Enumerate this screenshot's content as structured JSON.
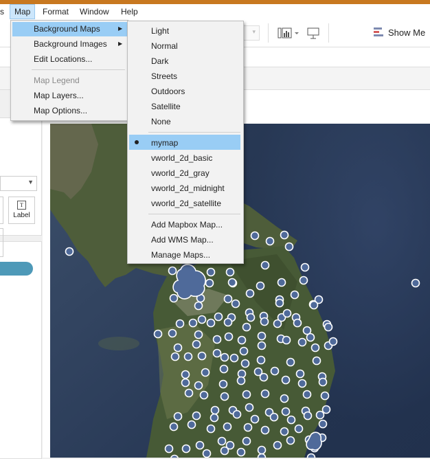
{
  "menubar": {
    "items": [
      {
        "label": "s"
      },
      {
        "label": "Map"
      },
      {
        "label": "Format"
      },
      {
        "label": "Window"
      },
      {
        "label": "Help"
      }
    ]
  },
  "toolbar": {
    "show_me_label": "Show Me"
  },
  "left_pane": {
    "label_button": "Label",
    "label_icon_glyph": "T"
  },
  "map_menu": {
    "items": [
      {
        "label": "Background Maps",
        "submenu": true,
        "highlighted": true
      },
      {
        "label": "Background Images",
        "submenu": true
      },
      {
        "label": "Edit Locations..."
      },
      {
        "label": "Map Legend",
        "disabled": true
      },
      {
        "label": "Map Layers..."
      },
      {
        "label": "Map Options..."
      }
    ]
  },
  "background_maps_menu": {
    "builtin": [
      "Light",
      "Normal",
      "Dark",
      "Streets",
      "Outdoors",
      "Satellite",
      "None"
    ],
    "custom": [
      "mymap",
      "vworld_2d_basic",
      "vworld_2d_gray",
      "vworld_2d_midnight",
      "vworld_2d_satellite"
    ],
    "selected": "mymap",
    "manage": [
      "Add Mapbox Map...",
      "Add WMS Map...",
      "Manage Maps..."
    ]
  },
  "colors": {
    "accent_strip": "#c87820",
    "menu_highlight": "#99cdf5",
    "map_point_fill": "#4f6a9a",
    "map_point_stroke": "#ffffff",
    "sea": "#2c3f5c",
    "land": "#4a5e3e"
  },
  "icons": [
    "chart-type-icon",
    "presentation-icon",
    "show-me-icon",
    "submenu-arrow-icon",
    "radio-dot-icon",
    "dropdown-caret-icon"
  ]
}
